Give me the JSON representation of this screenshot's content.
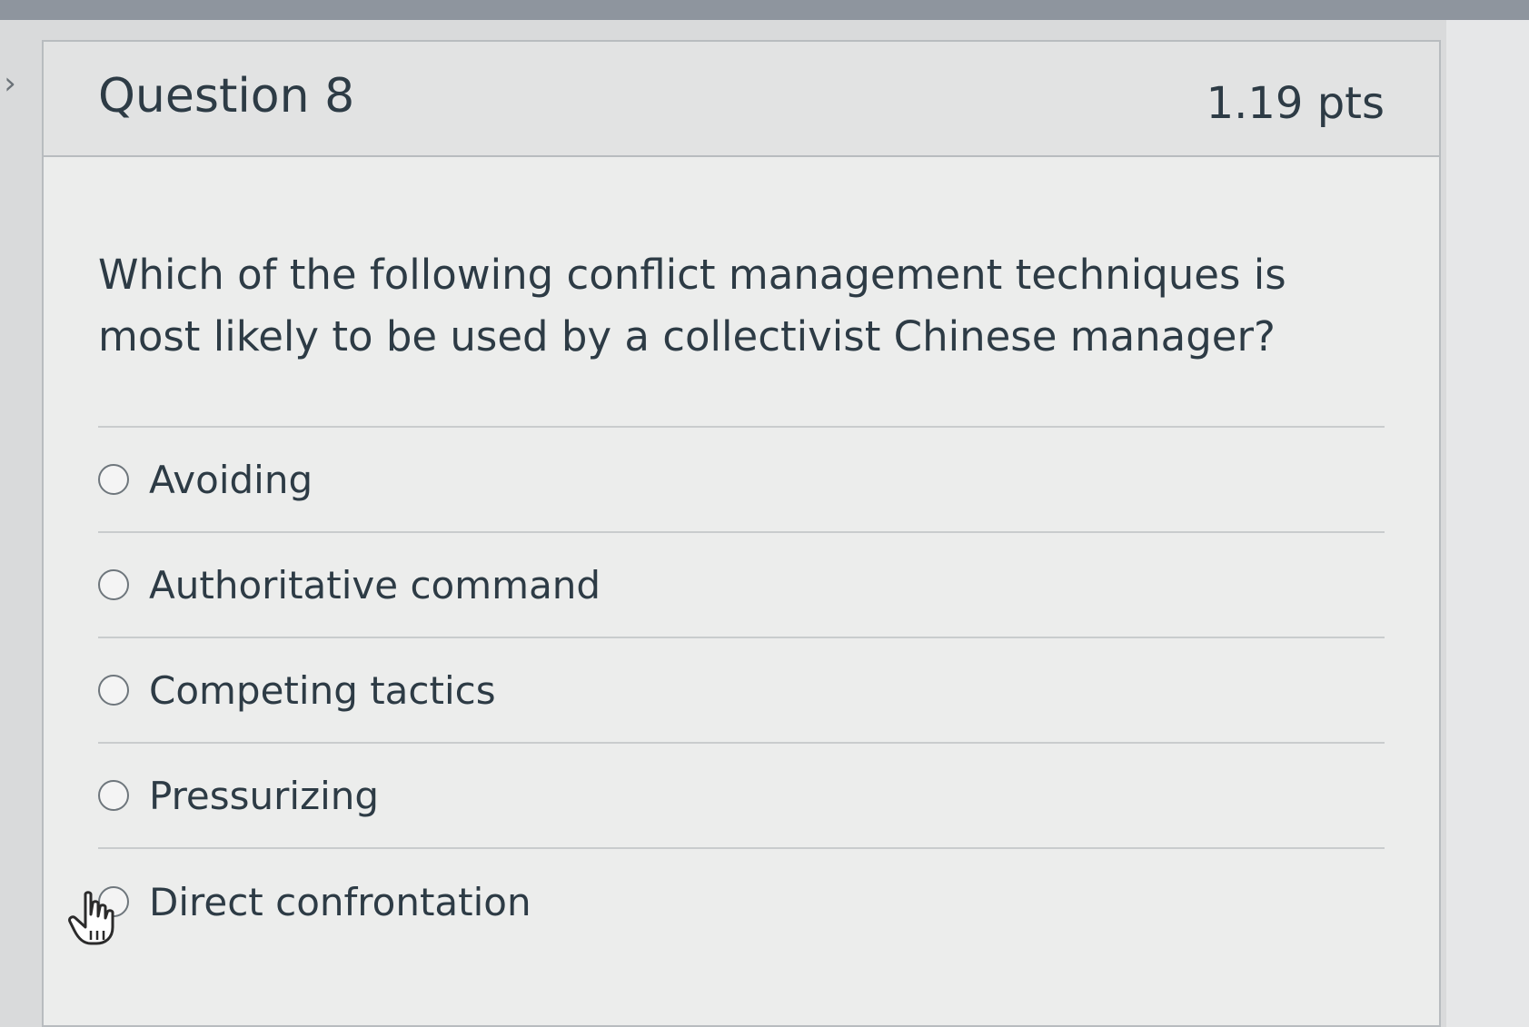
{
  "question": {
    "title": "Question 8",
    "points": "1.19 pts",
    "text": "Which of the following conflict management techniques is most likely to be used by a collectivist Chinese manager?"
  },
  "answers": [
    {
      "label": "Avoiding",
      "selected": false
    },
    {
      "label": "Authoritative command",
      "selected": false
    },
    {
      "label": "Competing tactics",
      "selected": false
    },
    {
      "label": "Pressurizing",
      "selected": false
    },
    {
      "label": "Direct confrontation",
      "selected": false
    }
  ],
  "icons": {
    "toggle": "chevron-right-icon",
    "cursor": "hand-pointer-icon"
  }
}
